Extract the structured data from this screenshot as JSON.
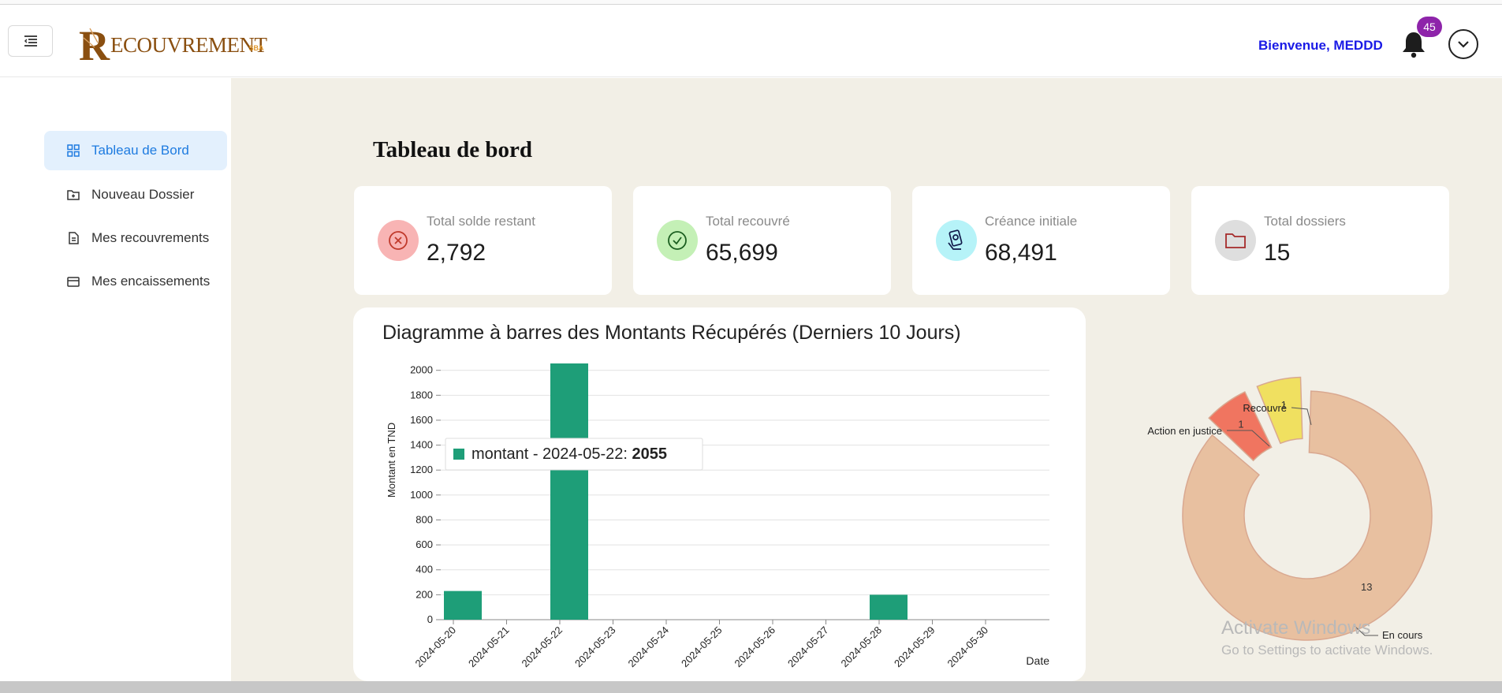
{
  "header": {
    "brand_initial": "R",
    "brand_rest": "ECOUVREMENT",
    "brand_sub": "SBA",
    "welcome": "Bienvenue, MEDDD",
    "notification_count": "45"
  },
  "sidebar": {
    "items": [
      {
        "label": "Tableau de Bord",
        "icon": "dashboard-grid-icon",
        "active": true
      },
      {
        "label": "Nouveau Dossier",
        "icon": "folder-plus-icon",
        "active": false
      },
      {
        "label": "Mes recouvrements",
        "icon": "document-icon",
        "active": false
      },
      {
        "label": "Mes encaissements",
        "icon": "wallet-icon",
        "active": false
      }
    ]
  },
  "main": {
    "title": "Tableau de bord",
    "cards": [
      {
        "label": "Total solde restant",
        "value": "2,792",
        "icon": "cancel-circle-icon",
        "color": "#f8b4b4"
      },
      {
        "label": "Total recouvré",
        "value": "65,699",
        "icon": "check-circle-icon",
        "color": "#c4f0b6"
      },
      {
        "label": "Créance initiale",
        "value": "68,491",
        "icon": "money-hand-icon",
        "color": "#b6f3f8"
      },
      {
        "label": "Total dossiers",
        "value": "15",
        "icon": "folder-icon",
        "color": "#dedede"
      }
    ]
  },
  "chart_data": [
    {
      "type": "bar",
      "title": "Diagramme à barres des Montants Récupérés (Derniers 10 Jours)",
      "xlabel": "Date",
      "ylabel": "Montant en TND",
      "categories": [
        "2024-05-20",
        "2024-05-21",
        "2024-05-22",
        "2024-05-23",
        "2024-05-24",
        "2024-05-25",
        "2024-05-26",
        "2024-05-27",
        "2024-05-28",
        "2024-05-29",
        "2024-05-30"
      ],
      "series": [
        {
          "name": "montant",
          "values": [
            230,
            0,
            2055,
            0,
            0,
            0,
            0,
            0,
            200,
            0,
            0
          ],
          "color": "#1e9e78"
        }
      ],
      "yticks": [
        0,
        200,
        400,
        600,
        800,
        1000,
        1200,
        1400,
        1600,
        1800,
        2000
      ],
      "ylim": [
        0,
        2055
      ],
      "grid": true,
      "tooltip": {
        "prefix": "montant - 2024-05-22: ",
        "value": "2055"
      }
    },
    {
      "type": "pie",
      "donut": true,
      "slices": [
        {
          "label": "En cours",
          "value": 13,
          "color": "#e8c0a0"
        },
        {
          "label": "Action en justice",
          "value": 1,
          "color": "#f07560"
        },
        {
          "label": "Recouvré",
          "value": 1,
          "color": "#f0e060"
        }
      ]
    }
  ],
  "watermark": {
    "line1": "Activate Windows",
    "line2": "Go to Settings to activate Windows."
  }
}
